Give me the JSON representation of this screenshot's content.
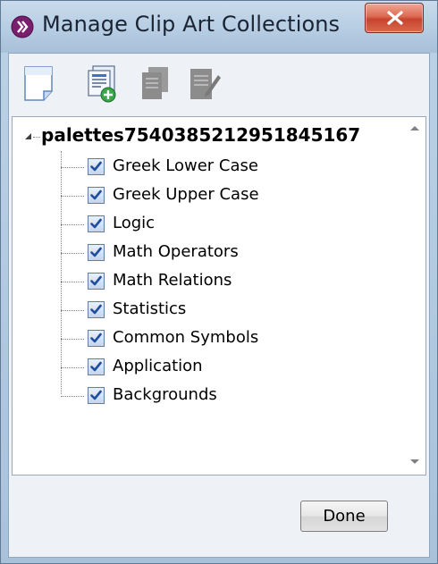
{
  "window": {
    "title": "Manage Clip Art Collections",
    "close_label": "X"
  },
  "toolbar": {
    "buttons": [
      {
        "name": "new-collection",
        "enabled": true
      },
      {
        "name": "add-clip-art",
        "enabled": true
      },
      {
        "name": "copy-collection",
        "enabled": false
      },
      {
        "name": "edit-collection",
        "enabled": false
      }
    ]
  },
  "tree": {
    "root_label": "palettes7540385212951845167",
    "items": [
      {
        "label": "Greek Lower Case",
        "checked": true
      },
      {
        "label": "Greek Upper Case",
        "checked": true
      },
      {
        "label": "Logic",
        "checked": true
      },
      {
        "label": "Math Operators",
        "checked": true
      },
      {
        "label": "Math Relations",
        "checked": true
      },
      {
        "label": "Statistics",
        "checked": true
      },
      {
        "label": "Common Symbols",
        "checked": true
      },
      {
        "label": "Application",
        "checked": true
      },
      {
        "label": "Backgrounds",
        "checked": true
      }
    ]
  },
  "footer": {
    "done_label": "Done"
  },
  "colors": {
    "title_bar": "#b6cde3",
    "close_button": "#c8432d",
    "checkbox_check": "#1e4f9c",
    "disabled_icon": "#8c8c8c"
  }
}
